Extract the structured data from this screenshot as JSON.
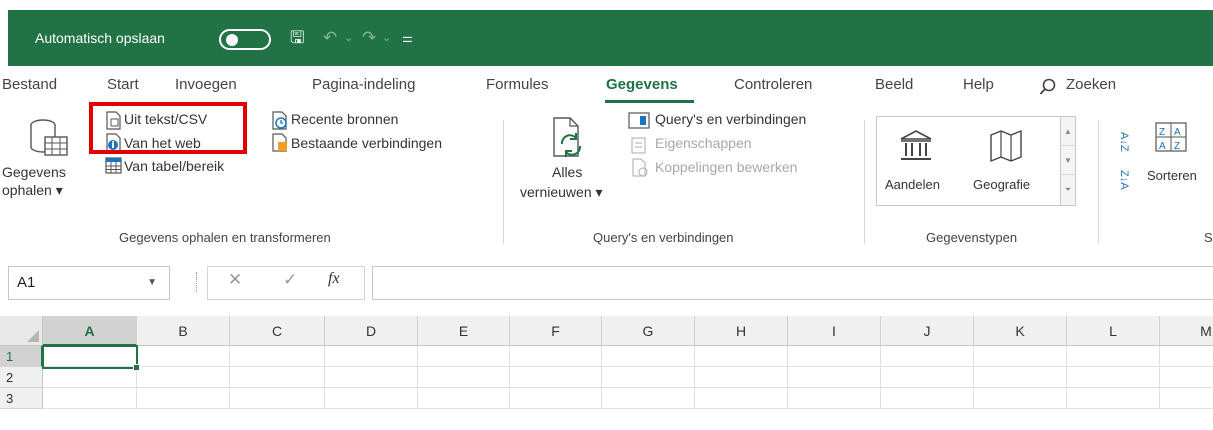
{
  "titlebar": {
    "autosave_label": "Automatisch opslaan",
    "qat_symbols": {
      "save": "🖫",
      "undo": "↶",
      "undo_dd": "⌄",
      "redo": "↷",
      "redo_dd": "⌄",
      "customize": "⚌"
    }
  },
  "tabs": [
    "Bestand",
    "Start",
    "Invoegen",
    "Pagina-indeling",
    "Formules",
    "Gegevens",
    "Controleren",
    "Beeld",
    "Help",
    "Zoeken"
  ],
  "active_tab": "Gegevens",
  "ribbon": {
    "get_data": {
      "line1": "Gegevens",
      "line2": "ophalen ▾"
    },
    "from_text_csv": "Uit tekst/CSV",
    "from_web": "Van het web",
    "from_table": "Van tabel/bereik",
    "recent_sources": "Recente bronnen",
    "existing_connections": "Bestaande verbindingen",
    "group1": "Gegevens ophalen en transformeren",
    "refresh_all": {
      "line1": "Alles",
      "line2": "vernieuwen ▾"
    },
    "queries_connections": "Query's en verbindingen",
    "properties": "Eigenschappen",
    "edit_links": "Koppelingen bewerken",
    "group2": "Query's en verbindingen",
    "stocks": "Aandelen",
    "geography": "Geografie",
    "group3": "Gegevenstypen",
    "sort": "Sorteren",
    "group4_partial": "S",
    "sort_az_icon": "A↓Z",
    "sort_za_icon": "Z↓A"
  },
  "formula_bar": {
    "name_box": "A1",
    "cancel": "✕",
    "enter": "✓",
    "fx": "fx",
    "value": ""
  },
  "grid": {
    "columns": [
      "A",
      "B",
      "C",
      "D",
      "E",
      "F",
      "G",
      "H",
      "I",
      "J",
      "K",
      "L",
      "M"
    ],
    "rows": [
      "1",
      "2",
      "3"
    ],
    "active_cell": "A1"
  },
  "colors": {
    "accent": "#217346",
    "highlight": "#e00000"
  }
}
